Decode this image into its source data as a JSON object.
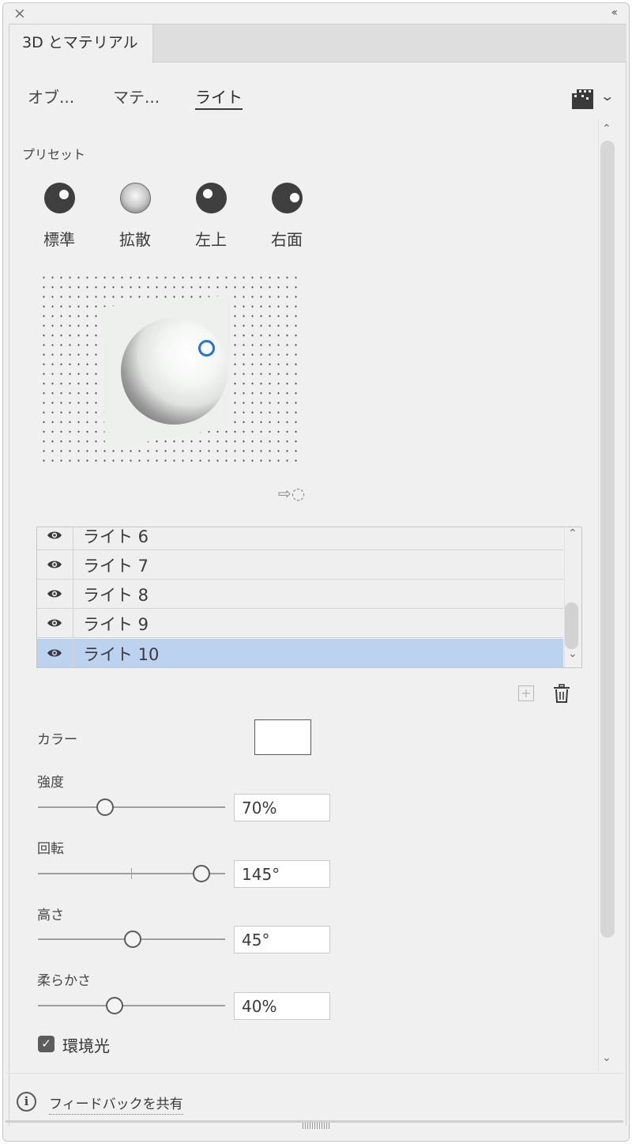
{
  "panel": {
    "tab_title": "3D とマテリアル"
  },
  "subtabs": [
    {
      "label": "オブ..."
    },
    {
      "label": "マテ..."
    },
    {
      "label": "ライト",
      "active": true
    }
  ],
  "presets": {
    "heading": "プリセット",
    "items": [
      {
        "label": "標準"
      },
      {
        "label": "拡散"
      },
      {
        "label": "左上"
      },
      {
        "label": "右面"
      }
    ]
  },
  "lights_list": {
    "items": [
      {
        "label": "ライト 6",
        "visible": true,
        "selected": false
      },
      {
        "label": "ライト 7",
        "visible": true,
        "selected": false
      },
      {
        "label": "ライト 8",
        "visible": true,
        "selected": false
      },
      {
        "label": "ライト 9",
        "visible": true,
        "selected": false
      },
      {
        "label": "ライト 10",
        "visible": true,
        "selected": true
      }
    ]
  },
  "properties": {
    "color_label": "カラー",
    "color_value": "#ffffff",
    "intensity": {
      "label": "強度",
      "value": "70%"
    },
    "rotation": {
      "label": "回転",
      "value": "145°"
    },
    "height": {
      "label": "高さ",
      "value": "45°"
    },
    "softness": {
      "label": "柔らかさ",
      "value": "40%"
    },
    "ambient": {
      "label": "環境光",
      "checked": true
    }
  },
  "footer": {
    "feedback_label": "フィードバックを共有"
  },
  "colors": {
    "accent": "#1a73e8",
    "selected_row": "#bcd3ef"
  }
}
